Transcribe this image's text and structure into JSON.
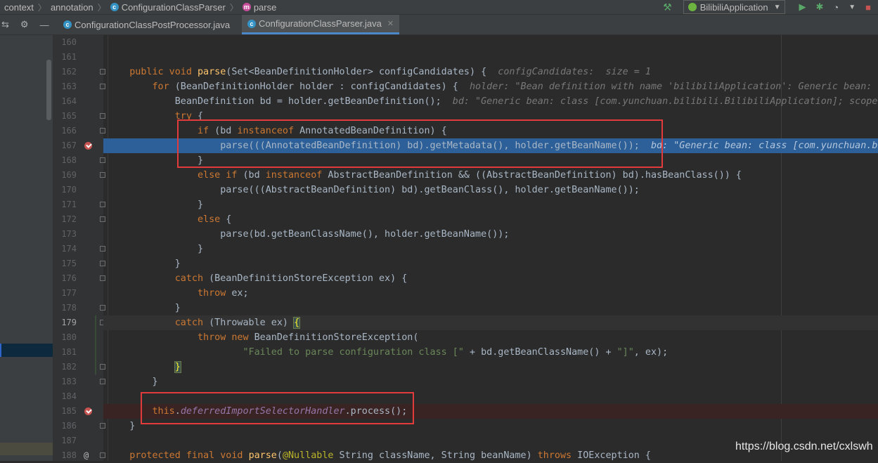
{
  "breadcrumb": [
    "context",
    "annotation",
    "ConfigurationClassParser",
    "parse"
  ],
  "toolbar": {
    "run_config": "BilibiliApplication"
  },
  "tabs": [
    {
      "label": "ConfigurationClassPostProcessor.java"
    },
    {
      "label": "ConfigurationClassParser.java"
    }
  ],
  "gutter": {
    "line_numbers": [
      "160",
      "161",
      "162",
      "163",
      "164",
      "165",
      "166",
      "167",
      "168",
      "169",
      "170",
      "171",
      "172",
      "173",
      "174",
      "175",
      "176",
      "177",
      "178",
      "179",
      "180",
      "181",
      "182",
      "183",
      "184",
      "185",
      "186",
      "187",
      "188"
    ]
  },
  "code": {
    "l162_a": "public void ",
    "l162_fn": "parse",
    "l162_b": "(Set<BeanDefinitionHolder> configCandidates) {  ",
    "l162_hint": "configCandidates:  size = 1",
    "l163_kw": "for",
    "l163_b": " (BeanDefinitionHolder holder : configCandidates) {  ",
    "l163_hint": "holder: \"Bean definition with name 'bilibiliApplication': Generic bean: c",
    "l164_a": "BeanDefinition bd = holder.getBeanDefinition();  ",
    "l164_hint": "bd: \"Generic bean: class [com.yunchuan.bilibili.BilibiliApplication]; scope=",
    "l165_kw": "try",
    "l165_b": " {",
    "l166_kw1": "if",
    "l166_b": " (bd ",
    "l166_kw2": "instanceof",
    "l166_c": " AnnotatedBeanDefinition) {",
    "l167_a": "parse(((AnnotatedBeanDefinition) bd).getMetadata(), holder.getBeanName());  ",
    "l167_hint": "bd: \"Generic bean: class [com.yunchuan.bi",
    "l168_a": "}",
    "l169_kw1": "else if",
    "l169_b": " (bd ",
    "l169_kw2": "instanceof",
    "l169_c": " AbstractBeanDefinition && ((AbstractBeanDefinition) bd).hasBeanClass()) {",
    "l170_a": "parse(((AbstractBeanDefinition) bd).getBeanClass(), holder.getBeanName());",
    "l171_a": "}",
    "l172_kw": "else",
    "l172_b": " {",
    "l173_a": "parse(bd.getBeanClassName(), holder.getBeanName());",
    "l174_a": "}",
    "l175_a": "}",
    "l176_kw": "catch",
    "l176_b": " (BeanDefinitionStoreException ex) {",
    "l177_kw": "throw",
    "l177_b": " ex;",
    "l178_a": "}",
    "l179_kw": "catch",
    "l179_b": " (Throwable ex) ",
    "l179_brace": "{",
    "l180_kw1": "throw",
    "l180_kw2": " new",
    "l180_b": " BeanDefinitionStoreException(",
    "l181_str": "\"Failed to parse configuration class [\"",
    "l181_b": " + bd.getBeanClassName() + ",
    "l181_str2": "\"]\"",
    "l181_c": ", ex);",
    "l182_brace": "}",
    "l183_a": "}",
    "l185_kw": "this",
    "l185_dot": ".",
    "l185_fld": "deferredImportSelectorHandler",
    "l185_b": ".process();",
    "l186_a": "}",
    "l188_kw": "protected final void ",
    "l188_fn": "parse",
    "l188_b": "(",
    "l188_ann": "@Nullable",
    "l188_c": " String className, String beanName) ",
    "l188_kw2": "throws",
    "l188_d": " IOException {"
  },
  "watermark": "https://blog.csdn.net/cxlswh",
  "colors": {
    "keyword": "#cc7832",
    "method": "#ffc66d",
    "string": "#6a8759",
    "field": "#9876aa",
    "exec_line": "#2d6099",
    "highlight_box": "#e23b3b"
  }
}
